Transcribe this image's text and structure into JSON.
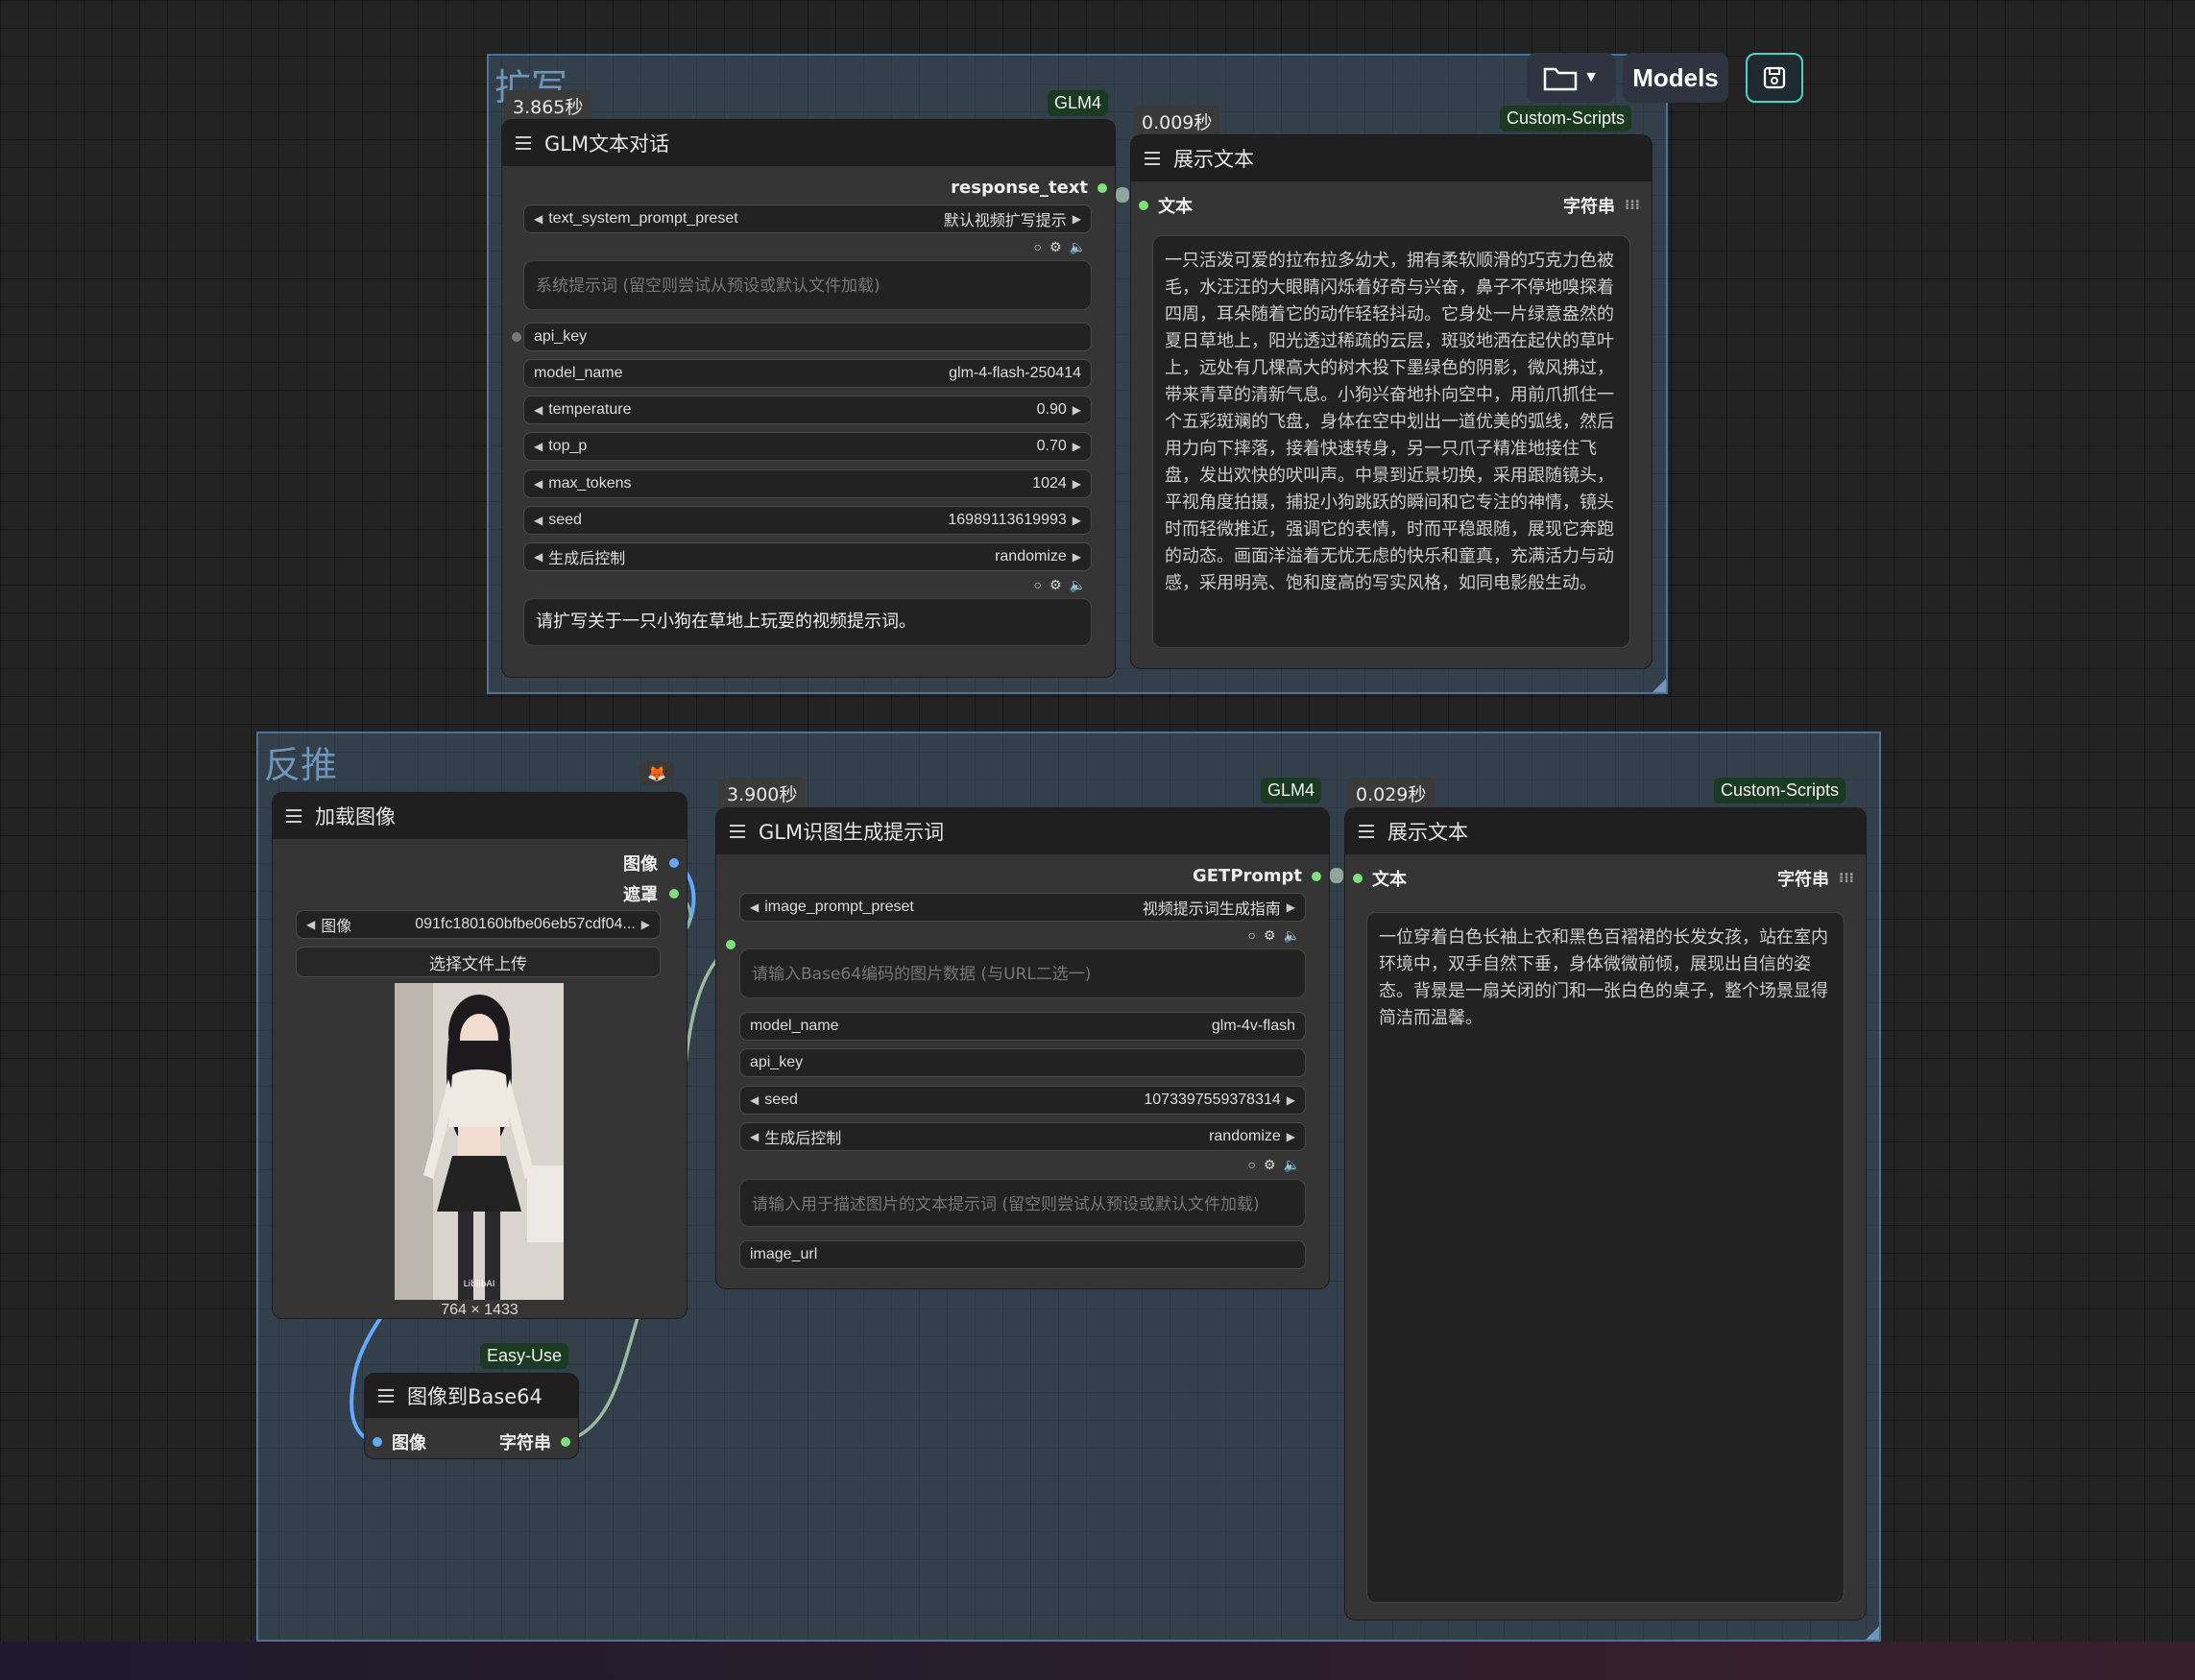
{
  "toolbar": {
    "folder_icon": "folder-icon",
    "models_label": "Models",
    "save_icon": "save-icon"
  },
  "groups": {
    "expand": {
      "title": "扩写"
    },
    "reverse": {
      "title": "反推"
    }
  },
  "glm_text_node": {
    "time": "3.865秒",
    "tag": "GLM4",
    "title": "GLM文本对话",
    "output_label": "response_text",
    "preset_label": "text_system_prompt_preset",
    "preset_value": "默认视频扩写提示",
    "system_placeholder": "系统提示词 (留空则尝试从预设或默认文件加载)",
    "api_key_label": "api_key",
    "model_name_label": "model_name",
    "model_name_value": "glm-4-flash-250414",
    "temperature_label": "temperature",
    "temperature_value": "0.90",
    "top_p_label": "top_p",
    "top_p_value": "0.70",
    "max_tokens_label": "max_tokens",
    "max_tokens_value": "1024",
    "seed_label": "seed",
    "seed_value": "16989113619993",
    "control_label": "生成后控制",
    "control_value": "randomize",
    "user_prompt": "请扩写关于一只小狗在草地上玩耍的视频提示词。"
  },
  "show_text_node_1": {
    "time": "0.009秒",
    "tag": "Custom-Scripts",
    "title": "展示文本",
    "input_label": "文本",
    "output_label": "字符串",
    "content": "一只活泼可爱的拉布拉多幼犬，拥有柔软顺滑的巧克力色被毛，水汪汪的大眼睛闪烁着好奇与兴奋，鼻子不停地嗅探着四周，耳朵随着它的动作轻轻抖动。它身处一片绿意盎然的夏日草地上，阳光透过稀疏的云层，斑驳地洒在起伏的草叶上，远处有几棵高大的树木投下墨绿色的阴影，微风拂过，带来青草的清新气息。小狗兴奋地扑向空中，用前爪抓住一个五彩斑斓的飞盘，身体在空中划出一道优美的弧线，然后用力向下摔落，接着快速转身，另一只爪子精准地接住飞盘，发出欢快的吠叫声。中景到近景切换，采用跟随镜头，平视角度拍摄，捕捉小狗跳跃的瞬间和它专注的神情，镜头时而轻微推近，强调它的表情，时而平稳跟随，展现它奔跑的动态。画面洋溢着无忧无虑的快乐和童真，充满活力与动感，采用明亮、饱和度高的写实风格，如同电影般生动。"
  },
  "load_image_node": {
    "title": "加载图像",
    "out_image": "图像",
    "out_mask": "遮罩",
    "image_label": "图像",
    "image_value": "091fc180160bfbe06eb57cdf04...",
    "upload_label": "选择文件上传",
    "dimensions": "764 × 1433",
    "watermark": "LiblibAI"
  },
  "glm_vision_node": {
    "time": "3.900秒",
    "tag": "GLM4",
    "title": "GLM识图生成提示词",
    "output_label": "GETPrompt",
    "preset_label": "image_prompt_preset",
    "preset_value": "视频提示词生成指南",
    "base64_placeholder": "请输入Base64编码的图片数据 (与URL二选一)",
    "model_name_label": "model_name",
    "model_name_value": "glm-4v-flash",
    "api_key_label": "api_key",
    "seed_label": "seed",
    "seed_value": "1073397559378314",
    "control_label": "生成后控制",
    "control_value": "randomize",
    "prompt_placeholder": "请输入用于描述图片的文本提示词 (留空则尝试从预设或默认文件加载)",
    "image_url_label": "image_url"
  },
  "show_text_node_2": {
    "time": "0.029秒",
    "tag": "Custom-Scripts",
    "title": "展示文本",
    "input_label": "文本",
    "output_label": "字符串",
    "content": "一位穿着白色长袖上衣和黑色百褶裙的长发女孩，站在室内环境中，双手自然下垂，身体微微前倾，展现出自信的姿态。背景是一扇关闭的门和一张白色的桌子，整个场景显得简洁而温馨。"
  },
  "base64_node": {
    "tag": "Easy-Use",
    "title": "图像到Base64",
    "input_label": "图像",
    "output_label": "字符串"
  }
}
